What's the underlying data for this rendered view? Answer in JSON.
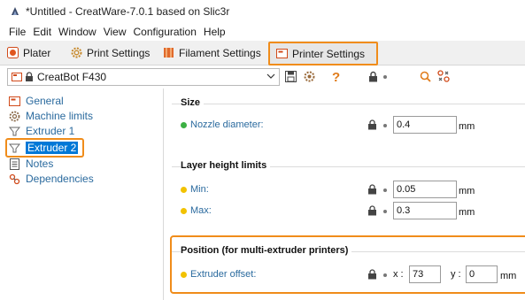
{
  "window": {
    "title": "*Untitled - CreatWare-7.0.1 based on Slic3r"
  },
  "menu": [
    "File",
    "Edit",
    "Window",
    "View",
    "Configuration",
    "Help"
  ],
  "tabs": {
    "plater": "Plater",
    "print_settings": "Print Settings",
    "filament_settings": "Filament Settings",
    "printer_settings": "Printer Settings"
  },
  "preset": {
    "selected": "CreatBot F430"
  },
  "toolbar_icons": [
    "save-icon",
    "delete-gear-icon",
    "question-icon",
    "lock-icon",
    "bullet-icon",
    "search-icon",
    "compare-icon"
  ],
  "tree": {
    "items": [
      {
        "label": "General",
        "icon": "printer-icon"
      },
      {
        "label": "Machine limits",
        "icon": "gear-icon"
      },
      {
        "label": "Extruder 1",
        "icon": "funnel-icon"
      },
      {
        "label": "Extruder 2",
        "icon": "funnel-icon",
        "selected": true
      },
      {
        "label": "Notes",
        "icon": "notes-icon"
      },
      {
        "label": "Dependencies",
        "icon": "dependencies-icon"
      }
    ]
  },
  "groups": {
    "size": {
      "title": "Size",
      "nozzle_diameter": {
        "label": "Nozzle diameter:",
        "value": "0.4",
        "unit": "mm",
        "dot_color": "#3cb043"
      }
    },
    "layer_height": {
      "title": "Layer height limits",
      "min": {
        "label": "Min:",
        "value": "0.05",
        "unit": "mm",
        "dot_color": "#f2c200"
      },
      "max": {
        "label": "Max:",
        "value": "0.3",
        "unit": "mm",
        "dot_color": "#f2c200"
      }
    },
    "position": {
      "title": "Position (for multi-extruder printers)",
      "extruder_offset": {
        "label": "Extruder offset:",
        "x_label": "x :",
        "x_value": "73",
        "y_label": "y :",
        "y_value": "0",
        "unit": "mm",
        "dot_color": "#f2c200"
      }
    }
  },
  "colors": {
    "accent_highlight": "#f08c1a",
    "selection": "#0078d7",
    "link_blue": "#2a6a9e"
  }
}
